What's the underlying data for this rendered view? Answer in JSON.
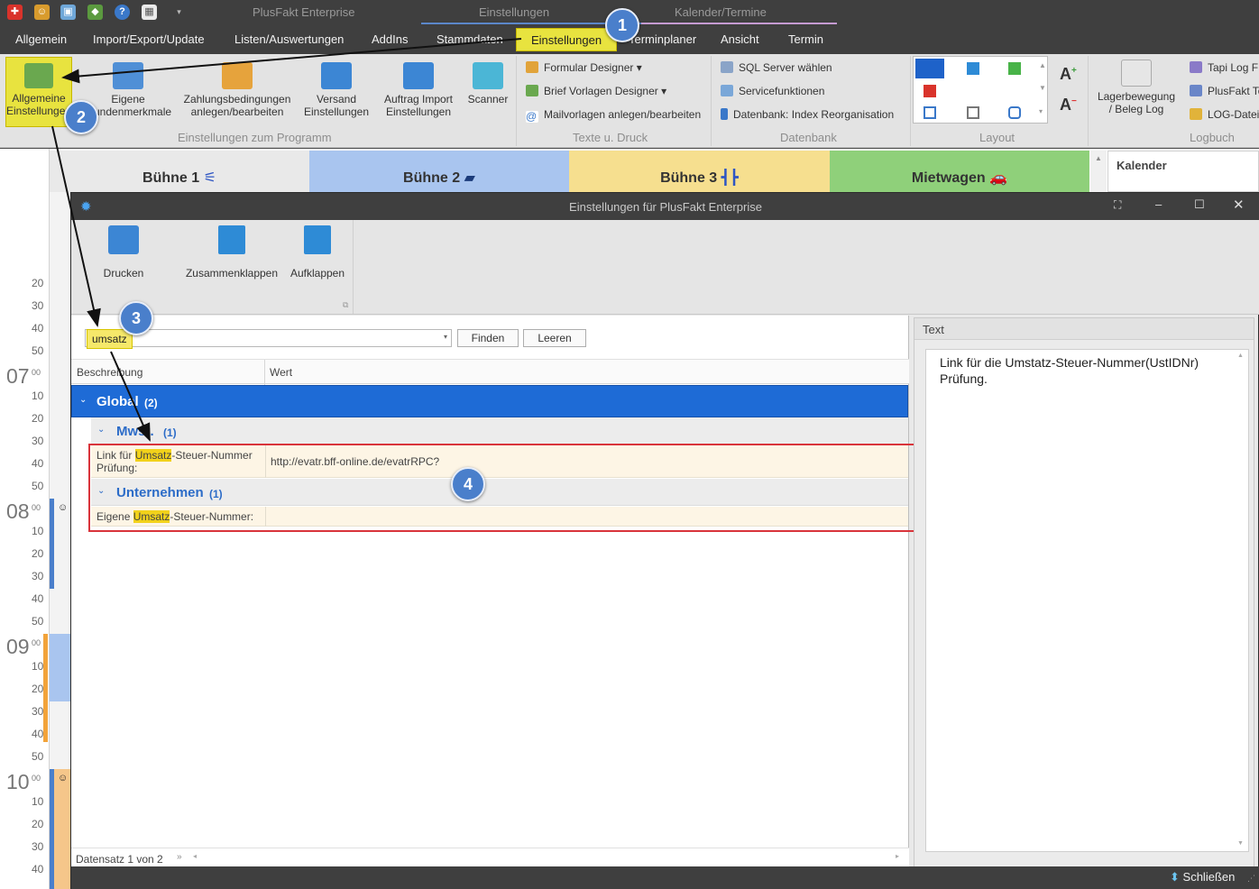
{
  "window": {
    "app_title": "PlusFakt Enterprise",
    "context_tab_1": "Einstellungen",
    "context_tab_2": "Kalender/Termine"
  },
  "tabs": [
    "Allgemein",
    "Import/Export/Update",
    "Listen/Auswertungen",
    "AddIns",
    "Stammdaten",
    "Einstellungen",
    "Terminplaner",
    "Ansicht",
    "Termin"
  ],
  "ribbon": {
    "btn_allgemeine": "Allgemeine\nEinstellungen",
    "btn_eigene": "Eigene\nKundenmerkmale",
    "btn_zahlung": "Zahlungsbedingungen\nanlegen/bearbeiten",
    "btn_versand": "Versand\nEinstellungen",
    "btn_auftrag": "Auftrag Import\nEinstellungen",
    "btn_scanner": "Scanner",
    "group_programm": "Einstellungen zum Programm",
    "texte": {
      "formular": "Formular Designer",
      "brief": "Brief Vorlagen Designer",
      "mail": "Mailvorlagen anlegen/bearbeiten",
      "group": "Texte u. Druck"
    },
    "datenbank": {
      "sql": "SQL Server wählen",
      "service": "Servicefunktionen",
      "index": "Datenbank: Index Reorganisation",
      "group": "Datenbank"
    },
    "layout_group": "Layout",
    "lager": "Lagerbewegung\n/ Beleg Log",
    "logbuch": {
      "tapi": "Tapi Log F",
      "plusfakt": "PlusFakt To",
      "logdatei": "LOG-Datei",
      "group": "Logbuch"
    }
  },
  "calendar": {
    "stages": [
      "Bühne 1",
      "Bühne 2",
      "Bühne 3",
      "Mietwagen"
    ],
    "kalender": "Kalender",
    "minute_labels": [
      "20",
      "30",
      "40",
      "50",
      "10",
      "20",
      "30",
      "40",
      "50",
      "10",
      "20",
      "30",
      "40",
      "50",
      "10",
      "20",
      "30",
      "40",
      "50",
      "10",
      "20",
      "30",
      "40"
    ],
    "hours": [
      "07",
      "08",
      "09",
      "10"
    ],
    "hour_suffix": "00"
  },
  "dialog": {
    "title": "Einstellungen für PlusFakt Enterprise",
    "toolbar": {
      "drucken": "Drucken",
      "zusammen": "Zusammenklappen",
      "auf": "Aufklappen"
    },
    "search": {
      "value": "umsatz",
      "find": "Finden",
      "clear": "Leeren"
    },
    "grid": {
      "col_desc": "Beschreibung",
      "col_value": "Wert",
      "group_global": "Global",
      "group_global_count": "(2)",
      "sub_mwst": "Mwst.",
      "sub_mwst_count": "(1)",
      "row1_pre": "Link für ",
      "row1_hl": "Umsatz",
      "row1_post": "-Steuer-Nummer",
      "row1_line2": "Prüfung:",
      "row1_value": "http://evatr.bff-online.de/evatrRPC?",
      "sub_unternehmen": "Unternehmen",
      "sub_unternehmen_count": "(1)",
      "row2_pre": "Eigene ",
      "row2_hl": "Umsatz",
      "row2_post": "-Steuer-Nummer:",
      "row2_value": ""
    },
    "text_panel": {
      "header": "Text",
      "content": "Link für die Umstatz-Steuer-Nummer(UstIDNr) Prüfung."
    },
    "record_nav": "Datensatz 1 von 2",
    "close_button": "Schließen"
  },
  "callouts": [
    "1",
    "2",
    "3",
    "4"
  ]
}
